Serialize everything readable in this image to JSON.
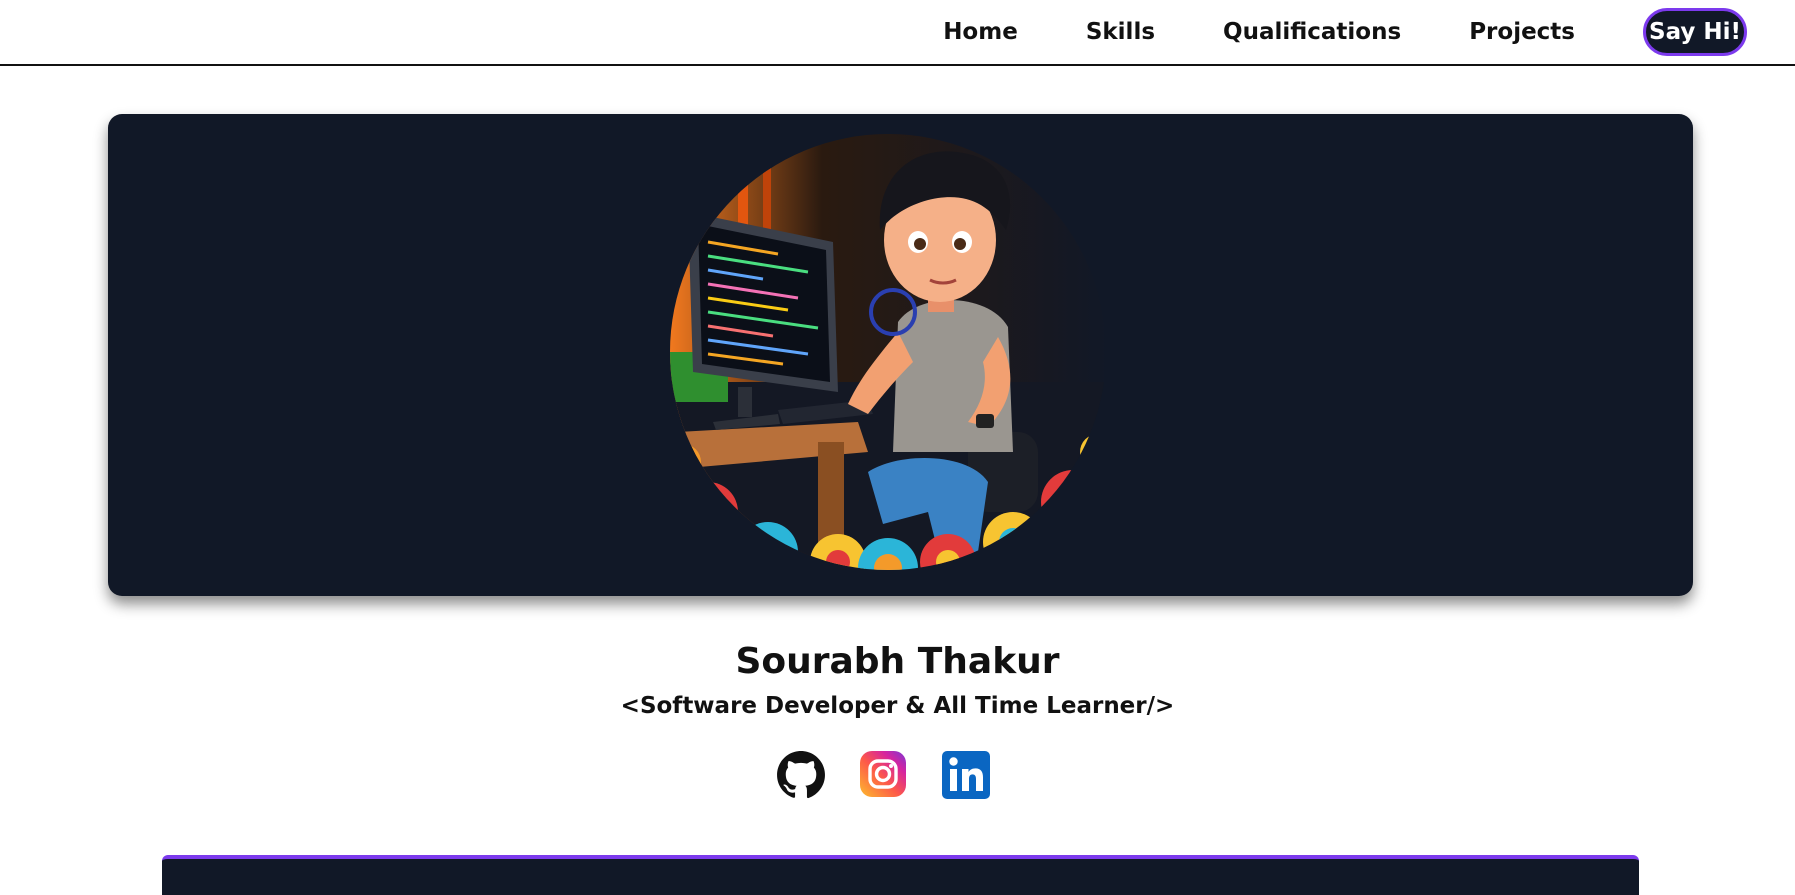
{
  "nav": {
    "items": [
      {
        "label": "Home"
      },
      {
        "label": "Skills"
      },
      {
        "label": "Qualifications"
      },
      {
        "label": "Projects"
      }
    ],
    "cta_label": "Say Hi!"
  },
  "hero": {
    "name": "Sourabh Thakur",
    "tagline": "<Software Developer & All Time Learner/>"
  },
  "socials": [
    {
      "icon": "github-icon"
    },
    {
      "icon": "instagram-icon"
    },
    {
      "icon": "linkedin-icon"
    }
  ],
  "colors": {
    "card_background": "#111827",
    "accent": "#7c3aed",
    "text": "#111111",
    "linkedin": "#0a66c2"
  }
}
